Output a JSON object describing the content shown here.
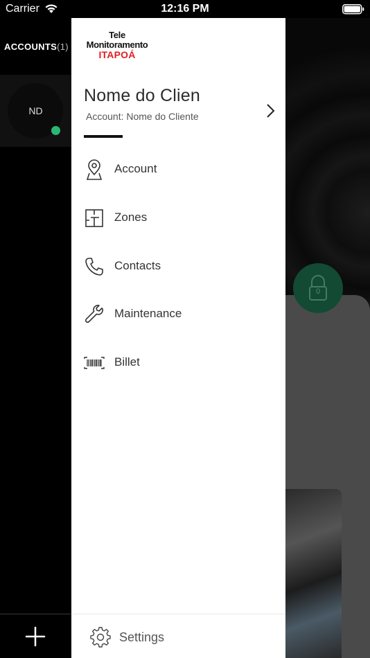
{
  "status_bar": {
    "carrier": "Carrier",
    "time": "12:16 PM"
  },
  "rail": {
    "title": "ACCOUNTS",
    "count": "(1)",
    "initials": "ND",
    "account_status_color": "#2bb673"
  },
  "logo": {
    "line1": "Tele",
    "line2": "Monitoramento",
    "line3": "ITAPOÁ"
  },
  "client": {
    "name": "Nome do Clien",
    "account": "Account: Nome do Cliente"
  },
  "menu": [
    {
      "label": "Account",
      "icon": "map-pin-icon"
    },
    {
      "label": "Zones",
      "icon": "floorplan-icon"
    },
    {
      "label": "Contacts",
      "icon": "phone-icon"
    },
    {
      "label": "Maintenance",
      "icon": "wrench-icon"
    },
    {
      "label": "Billet",
      "icon": "barcode-icon"
    }
  ],
  "settings": {
    "label": "Settings",
    "icon": "gear-icon"
  },
  "lock": {
    "label": "0",
    "color": "#124a33"
  }
}
